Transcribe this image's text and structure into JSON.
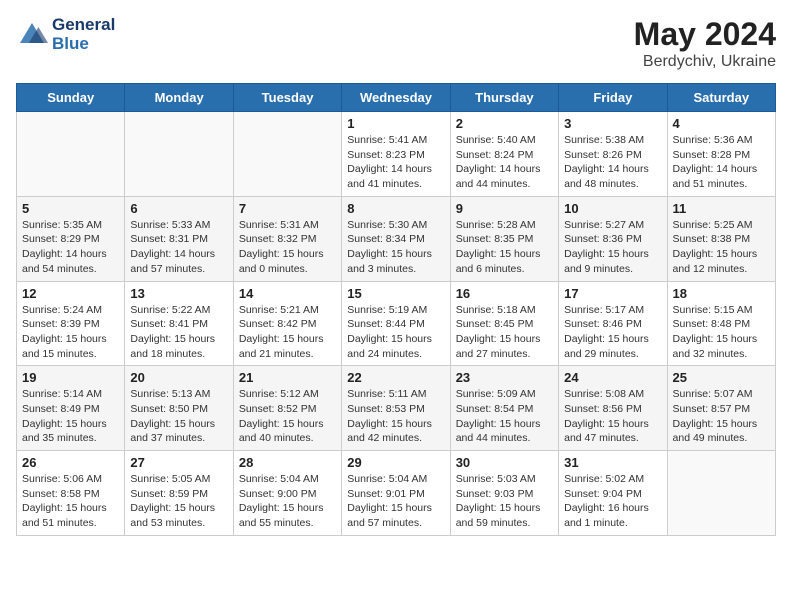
{
  "header": {
    "logo_line1": "General",
    "logo_line2": "Blue",
    "month_year": "May 2024",
    "location": "Berdychiv, Ukraine"
  },
  "weekdays": [
    "Sunday",
    "Monday",
    "Tuesday",
    "Wednesday",
    "Thursday",
    "Friday",
    "Saturday"
  ],
  "weeks": [
    [
      {
        "day": "",
        "info": ""
      },
      {
        "day": "",
        "info": ""
      },
      {
        "day": "",
        "info": ""
      },
      {
        "day": "1",
        "info": "Sunrise: 5:41 AM\nSunset: 8:23 PM\nDaylight: 14 hours\nand 41 minutes."
      },
      {
        "day": "2",
        "info": "Sunrise: 5:40 AM\nSunset: 8:24 PM\nDaylight: 14 hours\nand 44 minutes."
      },
      {
        "day": "3",
        "info": "Sunrise: 5:38 AM\nSunset: 8:26 PM\nDaylight: 14 hours\nand 48 minutes."
      },
      {
        "day": "4",
        "info": "Sunrise: 5:36 AM\nSunset: 8:28 PM\nDaylight: 14 hours\nand 51 minutes."
      }
    ],
    [
      {
        "day": "5",
        "info": "Sunrise: 5:35 AM\nSunset: 8:29 PM\nDaylight: 14 hours\nand 54 minutes."
      },
      {
        "day": "6",
        "info": "Sunrise: 5:33 AM\nSunset: 8:31 PM\nDaylight: 14 hours\nand 57 minutes."
      },
      {
        "day": "7",
        "info": "Sunrise: 5:31 AM\nSunset: 8:32 PM\nDaylight: 15 hours\nand 0 minutes."
      },
      {
        "day": "8",
        "info": "Sunrise: 5:30 AM\nSunset: 8:34 PM\nDaylight: 15 hours\nand 3 minutes."
      },
      {
        "day": "9",
        "info": "Sunrise: 5:28 AM\nSunset: 8:35 PM\nDaylight: 15 hours\nand 6 minutes."
      },
      {
        "day": "10",
        "info": "Sunrise: 5:27 AM\nSunset: 8:36 PM\nDaylight: 15 hours\nand 9 minutes."
      },
      {
        "day": "11",
        "info": "Sunrise: 5:25 AM\nSunset: 8:38 PM\nDaylight: 15 hours\nand 12 minutes."
      }
    ],
    [
      {
        "day": "12",
        "info": "Sunrise: 5:24 AM\nSunset: 8:39 PM\nDaylight: 15 hours\nand 15 minutes."
      },
      {
        "day": "13",
        "info": "Sunrise: 5:22 AM\nSunset: 8:41 PM\nDaylight: 15 hours\nand 18 minutes."
      },
      {
        "day": "14",
        "info": "Sunrise: 5:21 AM\nSunset: 8:42 PM\nDaylight: 15 hours\nand 21 minutes."
      },
      {
        "day": "15",
        "info": "Sunrise: 5:19 AM\nSunset: 8:44 PM\nDaylight: 15 hours\nand 24 minutes."
      },
      {
        "day": "16",
        "info": "Sunrise: 5:18 AM\nSunset: 8:45 PM\nDaylight: 15 hours\nand 27 minutes."
      },
      {
        "day": "17",
        "info": "Sunrise: 5:17 AM\nSunset: 8:46 PM\nDaylight: 15 hours\nand 29 minutes."
      },
      {
        "day": "18",
        "info": "Sunrise: 5:15 AM\nSunset: 8:48 PM\nDaylight: 15 hours\nand 32 minutes."
      }
    ],
    [
      {
        "day": "19",
        "info": "Sunrise: 5:14 AM\nSunset: 8:49 PM\nDaylight: 15 hours\nand 35 minutes."
      },
      {
        "day": "20",
        "info": "Sunrise: 5:13 AM\nSunset: 8:50 PM\nDaylight: 15 hours\nand 37 minutes."
      },
      {
        "day": "21",
        "info": "Sunrise: 5:12 AM\nSunset: 8:52 PM\nDaylight: 15 hours\nand 40 minutes."
      },
      {
        "day": "22",
        "info": "Sunrise: 5:11 AM\nSunset: 8:53 PM\nDaylight: 15 hours\nand 42 minutes."
      },
      {
        "day": "23",
        "info": "Sunrise: 5:09 AM\nSunset: 8:54 PM\nDaylight: 15 hours\nand 44 minutes."
      },
      {
        "day": "24",
        "info": "Sunrise: 5:08 AM\nSunset: 8:56 PM\nDaylight: 15 hours\nand 47 minutes."
      },
      {
        "day": "25",
        "info": "Sunrise: 5:07 AM\nSunset: 8:57 PM\nDaylight: 15 hours\nand 49 minutes."
      }
    ],
    [
      {
        "day": "26",
        "info": "Sunrise: 5:06 AM\nSunset: 8:58 PM\nDaylight: 15 hours\nand 51 minutes."
      },
      {
        "day": "27",
        "info": "Sunrise: 5:05 AM\nSunset: 8:59 PM\nDaylight: 15 hours\nand 53 minutes."
      },
      {
        "day": "28",
        "info": "Sunrise: 5:04 AM\nSunset: 9:00 PM\nDaylight: 15 hours\nand 55 minutes."
      },
      {
        "day": "29",
        "info": "Sunrise: 5:04 AM\nSunset: 9:01 PM\nDaylight: 15 hours\nand 57 minutes."
      },
      {
        "day": "30",
        "info": "Sunrise: 5:03 AM\nSunset: 9:03 PM\nDaylight: 15 hours\nand 59 minutes."
      },
      {
        "day": "31",
        "info": "Sunrise: 5:02 AM\nSunset: 9:04 PM\nDaylight: 16 hours\nand 1 minute."
      },
      {
        "day": "",
        "info": ""
      }
    ]
  ]
}
